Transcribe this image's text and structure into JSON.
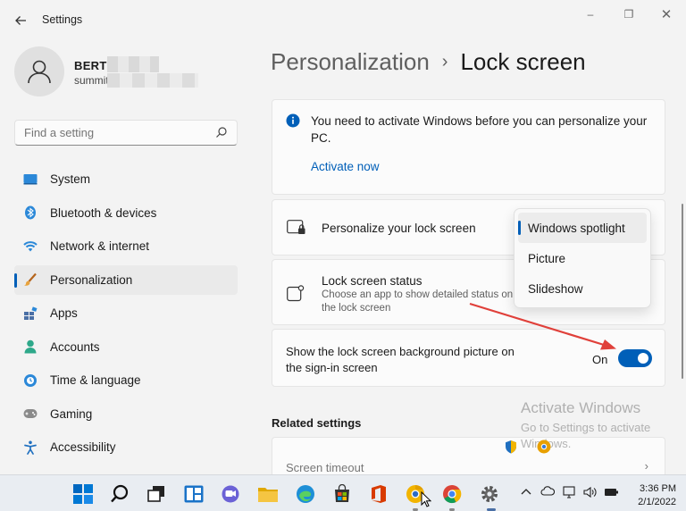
{
  "window": {
    "title": "Settings",
    "back_icon": "back-arrow-icon",
    "controls": {
      "minimize": "–",
      "maximize": "❐",
      "close": "✕"
    }
  },
  "profile": {
    "name": "BERTS",
    "email": "summit"
  },
  "search": {
    "placeholder": "Find a setting",
    "icon": "search-icon"
  },
  "sidebar": {
    "items": [
      {
        "label": "System",
        "icon": "system-icon",
        "active": false
      },
      {
        "label": "Bluetooth & devices",
        "icon": "bluetooth-icon",
        "active": false
      },
      {
        "label": "Network & internet",
        "icon": "wifi-icon",
        "active": false
      },
      {
        "label": "Personalization",
        "icon": "brush-icon",
        "active": true
      },
      {
        "label": "Apps",
        "icon": "apps-icon",
        "active": false
      },
      {
        "label": "Accounts",
        "icon": "accounts-icon",
        "active": false
      },
      {
        "label": "Time & language",
        "icon": "time-language-icon",
        "active": false
      },
      {
        "label": "Gaming",
        "icon": "gaming-icon",
        "active": false
      },
      {
        "label": "Accessibility",
        "icon": "accessibility-icon",
        "active": false
      }
    ]
  },
  "breadcrumb": {
    "parent": "Personalization",
    "separator": "›",
    "current": "Lock screen"
  },
  "activation": {
    "message": "You need to activate Windows before you can personalize your PC.",
    "link": "Activate now"
  },
  "personalize": {
    "label": "Personalize your lock screen",
    "dropdown": {
      "options": [
        "Windows spotlight",
        "Picture",
        "Slideshow"
      ],
      "selected": "Windows spotlight"
    }
  },
  "lock_status": {
    "label": "Lock screen status",
    "description": "Choose an app to show detailed status on the lock screen"
  },
  "signin_background": {
    "label": "Show the lock screen background picture on the sign-in screen",
    "state": "On",
    "enabled": true
  },
  "related": {
    "heading": "Related settings",
    "items": [
      {
        "label": "Screen timeout",
        "chevron": "›"
      }
    ]
  },
  "watermark": {
    "line1": "Activate Windows",
    "line2": "Go to Settings to activate Windows."
  },
  "taskbar": {
    "apps": [
      "start-icon",
      "search-icon",
      "task-view-icon",
      "widgets-icon",
      "chat-icon",
      "file-explorer-icon",
      "edge-icon",
      "store-icon",
      "office-icon",
      "chrome-canary-icon",
      "chrome-icon",
      "settings-icon"
    ],
    "time": "3:36 PM",
    "date": "2/1/2022"
  },
  "colors": {
    "accent": "#005fb8",
    "background": "#f3f3f3",
    "card": "#fbfbfb",
    "annotation_arrow": "#e0403a"
  }
}
